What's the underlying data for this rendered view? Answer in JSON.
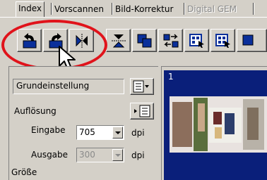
{
  "tabs": [
    {
      "label": "Index",
      "state": "active"
    },
    {
      "label": "Vorscannen",
      "state": "normal"
    },
    {
      "label": "Bild-Korrektur",
      "state": "normal"
    },
    {
      "label": "Digital GEM",
      "state": "disabled"
    }
  ],
  "toolbar": {
    "buttons": [
      {
        "icon": "rotate-left-icon"
      },
      {
        "icon": "rotate-right-icon"
      },
      {
        "icon": "flip-horizontal-icon"
      },
      {
        "icon": "flip-vertical-icon"
      },
      {
        "icon": "copy-frames-icon"
      },
      {
        "icon": "swap-frames-icon"
      },
      {
        "icon": "select-frames-icon"
      },
      {
        "icon": "select-all-frames-icon"
      }
    ]
  },
  "settings": {
    "preset_value": "Grundeinstellung",
    "resolution_label": "Auflösung",
    "input_label": "Eingabe",
    "input_value": "705",
    "input_unit": "dpi",
    "output_label": "Ausgabe",
    "output_value": "300",
    "output_unit": "dpi",
    "size_label": "Größe"
  },
  "preview": {
    "frame_number": "1"
  },
  "colors": {
    "highlight_circle": "#e0131b",
    "frame_background": "#0a1f7a",
    "window_face": "#d4d0c8"
  }
}
